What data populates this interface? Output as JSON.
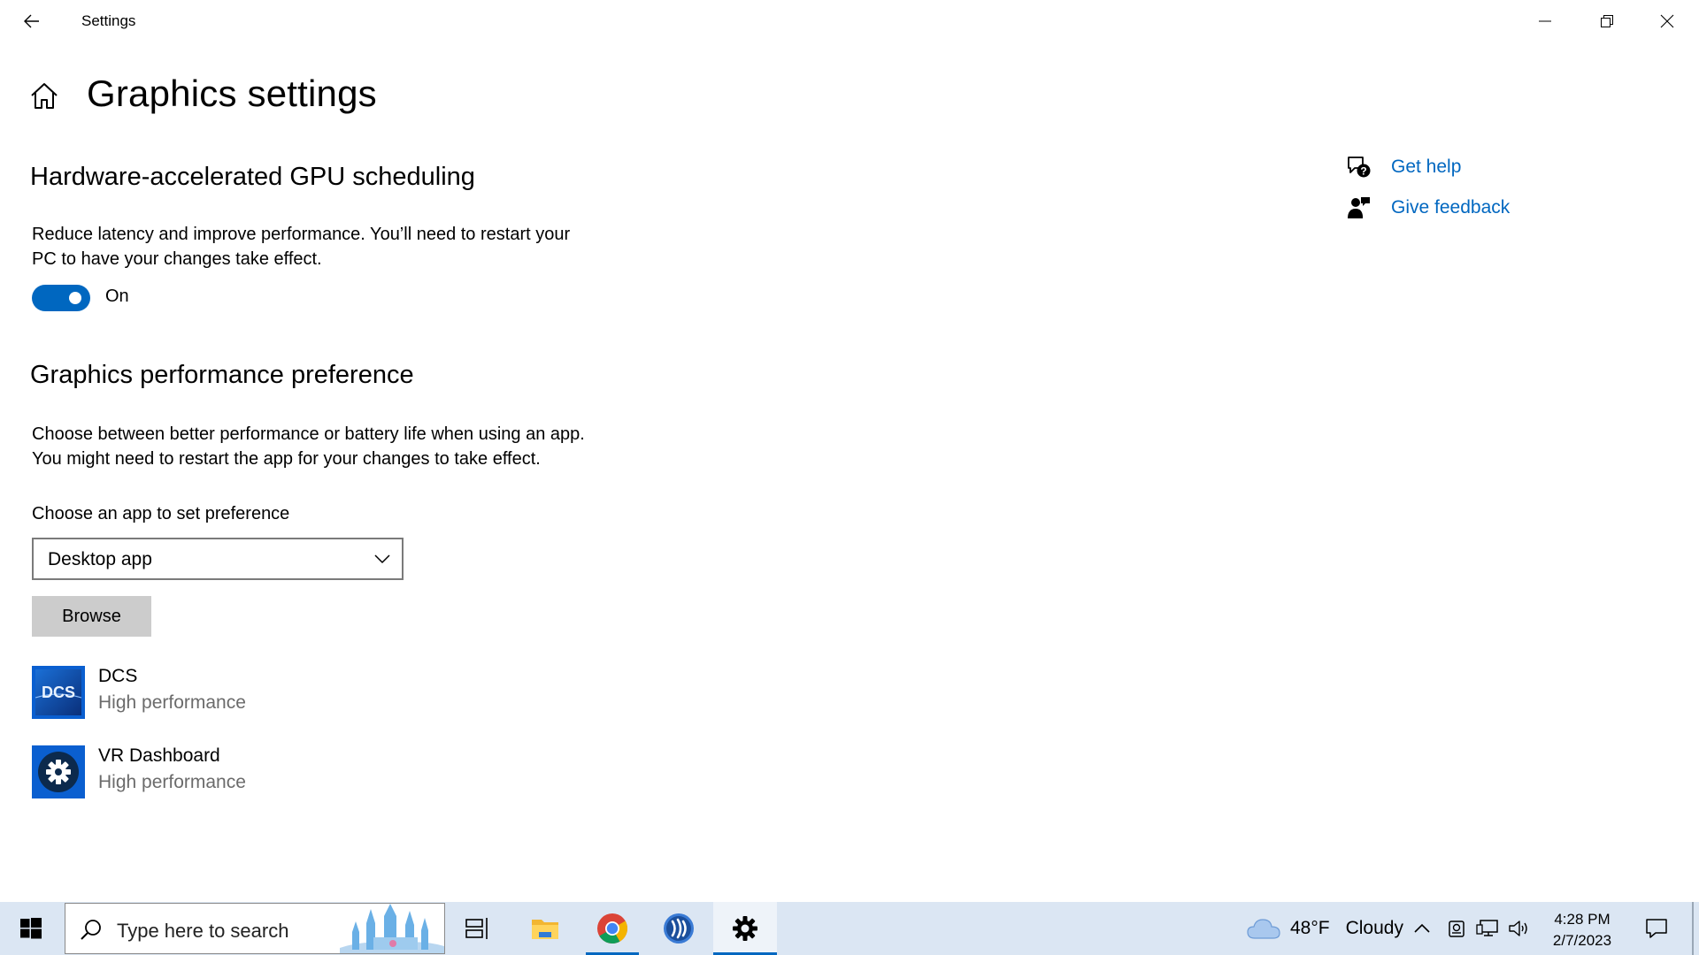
{
  "window": {
    "title": "Settings"
  },
  "page": {
    "title": "Graphics settings"
  },
  "gpu_scheduling": {
    "heading": "Hardware-accelerated GPU scheduling",
    "description_line1": "Reduce latency and improve performance. You’ll need to restart your",
    "description_line2": "PC to have your changes take effect.",
    "toggle_state": "On"
  },
  "performance_preference": {
    "heading": "Graphics performance preference",
    "description_line1": "Choose between better performance or battery life when using an app.",
    "description_line2": "You might need to restart the app for your changes to take effect.",
    "choose_label": "Choose an app to set preference",
    "dropdown_value": "Desktop app",
    "browse_label": "Browse",
    "apps": [
      {
        "name": "DCS",
        "preference": "High performance",
        "icon_text": "DCS"
      },
      {
        "name": "VR Dashboard",
        "preference": "High performance"
      }
    ]
  },
  "help": {
    "get_help": "Get help",
    "give_feedback": "Give feedback"
  },
  "taskbar": {
    "search_placeholder": "Type here to search",
    "weather_temp": "48°F",
    "weather_condition": "Cloudy",
    "time": "4:28 PM",
    "date": "2/7/2023"
  },
  "colors": {
    "accent": "#0067c0",
    "taskbar_bg": "#dbe6f3"
  }
}
